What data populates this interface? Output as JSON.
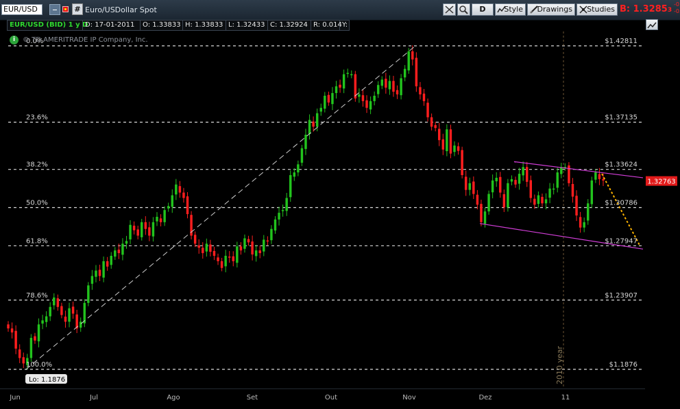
{
  "toolbar": {
    "symbol": "EUR/USD",
    "description": "Euro/USDollar Spot",
    "buttons": {
      "period": "D",
      "style": "Style",
      "drawings": "Drawings",
      "studies": "Studies"
    },
    "bid_label": "B: 1.3285",
    "bid_superscript": "3",
    "bid_tiny_top": "-0",
    "bid_tiny_bottom": "-0."
  },
  "infobar": {
    "symbol_period": "EUR/USD (BID) 1 y D",
    "date": "D: 17-01-2011",
    "open": "O: 1.33833",
    "high": "H: 1.33833",
    "low": "L: 1.32433",
    "close": "C: 1.32924",
    "range": "R: 0.014",
    "y": "Y:"
  },
  "copyright": "© TD AMERITRADE IP Company, Inc.",
  "info_icon": "info-icon",
  "last_price_tag": "1.32763",
  "low_tag": "Lo: 1.1876",
  "year_marker": "2010 year",
  "colors": {
    "up": "#22c31d",
    "down": "#ff1e1e",
    "fib_line": "#ffffff",
    "channel": "#d23ed8",
    "projection": "#ffb400",
    "price_tag": "#e21a1a"
  },
  "fib_levels": [
    {
      "label": "0.0%",
      "value": 1.42811,
      "price_label": "$1.42811"
    },
    {
      "label": "23.6%",
      "value": 1.37135,
      "price_label": "$1.37135"
    },
    {
      "label": "38.2%",
      "value": 1.33624,
      "price_label": "$1.33624"
    },
    {
      "label": "50.0%",
      "value": 1.30786,
      "price_label": "$1.30786"
    },
    {
      "label": "61.8%",
      "value": 1.27947,
      "price_label": "$1.27947"
    },
    {
      "label": "78.6%",
      "value": 1.23907,
      "price_label": "$1.23907"
    },
    {
      "label": "100.0%",
      "value": 1.1876,
      "price_label": "$1.1876"
    }
  ],
  "chart_data": {
    "type": "candlestick",
    "instrument": "EUR/USD (BID)",
    "timeframe": "1 y D",
    "x_ticks": [
      "Jun",
      "Jul",
      "Ago",
      "Set",
      "Out",
      "Nov",
      "Dez",
      "11"
    ],
    "y_range": [
      1.17,
      1.44
    ],
    "closes": [
      1.218,
      1.215,
      1.203,
      1.196,
      1.192,
      1.196,
      1.211,
      1.209,
      1.221,
      1.224,
      1.227,
      1.234,
      1.241,
      1.234,
      1.228,
      1.223,
      1.233,
      1.229,
      1.218,
      1.223,
      1.237,
      1.25,
      1.257,
      1.261,
      1.257,
      1.268,
      1.264,
      1.272,
      1.276,
      1.274,
      1.281,
      1.283,
      1.295,
      1.291,
      1.287,
      1.297,
      1.292,
      1.287,
      1.297,
      1.301,
      1.297,
      1.306,
      1.309,
      1.317,
      1.325,
      1.319,
      1.315,
      1.303,
      1.287,
      1.281,
      1.278,
      1.274,
      1.281,
      1.275,
      1.272,
      1.268,
      1.263,
      1.272,
      1.271,
      1.268,
      1.279,
      1.276,
      1.285,
      1.282,
      1.273,
      1.276,
      1.274,
      1.284,
      1.283,
      1.292,
      1.299,
      1.304,
      1.306,
      1.315,
      1.332,
      1.334,
      1.34,
      1.352,
      1.362,
      1.373,
      1.368,
      1.378,
      1.382,
      1.391,
      1.386,
      1.393,
      1.398,
      1.397,
      1.407,
      1.408,
      1.407,
      1.389,
      1.392,
      1.387,
      1.382,
      1.387,
      1.391,
      1.399,
      1.403,
      1.397,
      1.402,
      1.394,
      1.392,
      1.404,
      1.411,
      1.424,
      1.418,
      1.398,
      1.392,
      1.387,
      1.375,
      1.368,
      1.367,
      1.358,
      1.351,
      1.366,
      1.348,
      1.354,
      1.35,
      1.332,
      1.321,
      1.326,
      1.318,
      1.31,
      1.297,
      1.305,
      1.318,
      1.328,
      1.33,
      1.319,
      1.308,
      1.326,
      1.329,
      1.325,
      1.333,
      1.338,
      1.327,
      1.315,
      1.31,
      1.317,
      1.311,
      1.314,
      1.322,
      1.322,
      1.334,
      1.338,
      1.338,
      1.326,
      1.316,
      1.302,
      1.293,
      1.297,
      1.311,
      1.328,
      1.334,
      1.329,
      1.328
    ]
  }
}
